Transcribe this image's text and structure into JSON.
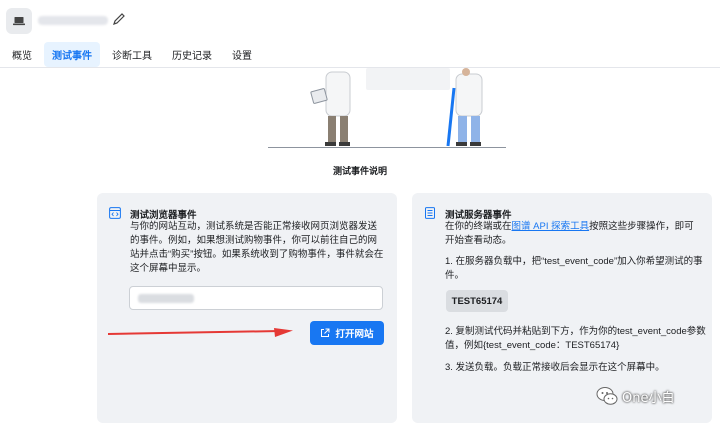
{
  "header": {
    "tabs": [
      {
        "label": "概览"
      },
      {
        "label": "测试事件"
      },
      {
        "label": "诊断工具"
      },
      {
        "label": "历史记录"
      },
      {
        "label": "设置"
      }
    ]
  },
  "hero": {
    "caption": "测试事件说明"
  },
  "browser_card": {
    "title": "测试浏览器事件",
    "description": "与你的网站互动，测试系统是否能正常接收网页浏览器发送的事件。例如，如果想测试购物事件，你可以前往自己的网站并点击“购买”按钮。如果系统收到了购物事件，事件就会在这个屏幕中显示。",
    "open_button_label": "打开网站"
  },
  "server_card": {
    "title": "测试服务器事件",
    "intro_prefix": "在你的终端或在",
    "intro_link": "图谱 API 探索工具",
    "intro_suffix": "按照这些步骤操作，即可开始查看动态。",
    "step1": "1. 在服务器负载中，把“test_event_code”加入你希望测试的事件。",
    "test_code": "TEST65174",
    "step2": "2. 复制测试代码并粘贴到下方，作为你的test_event_code参数值，例如{test_event_code：TEST65174}",
    "step3": "3. 发送负载。负载正常接收后会显示在这个屏幕中。"
  },
  "watermark": {
    "text": "One小白"
  },
  "colors": {
    "accent": "#1877f2",
    "arrow": "#e53935",
    "card_bg": "#f0f2f5"
  }
}
